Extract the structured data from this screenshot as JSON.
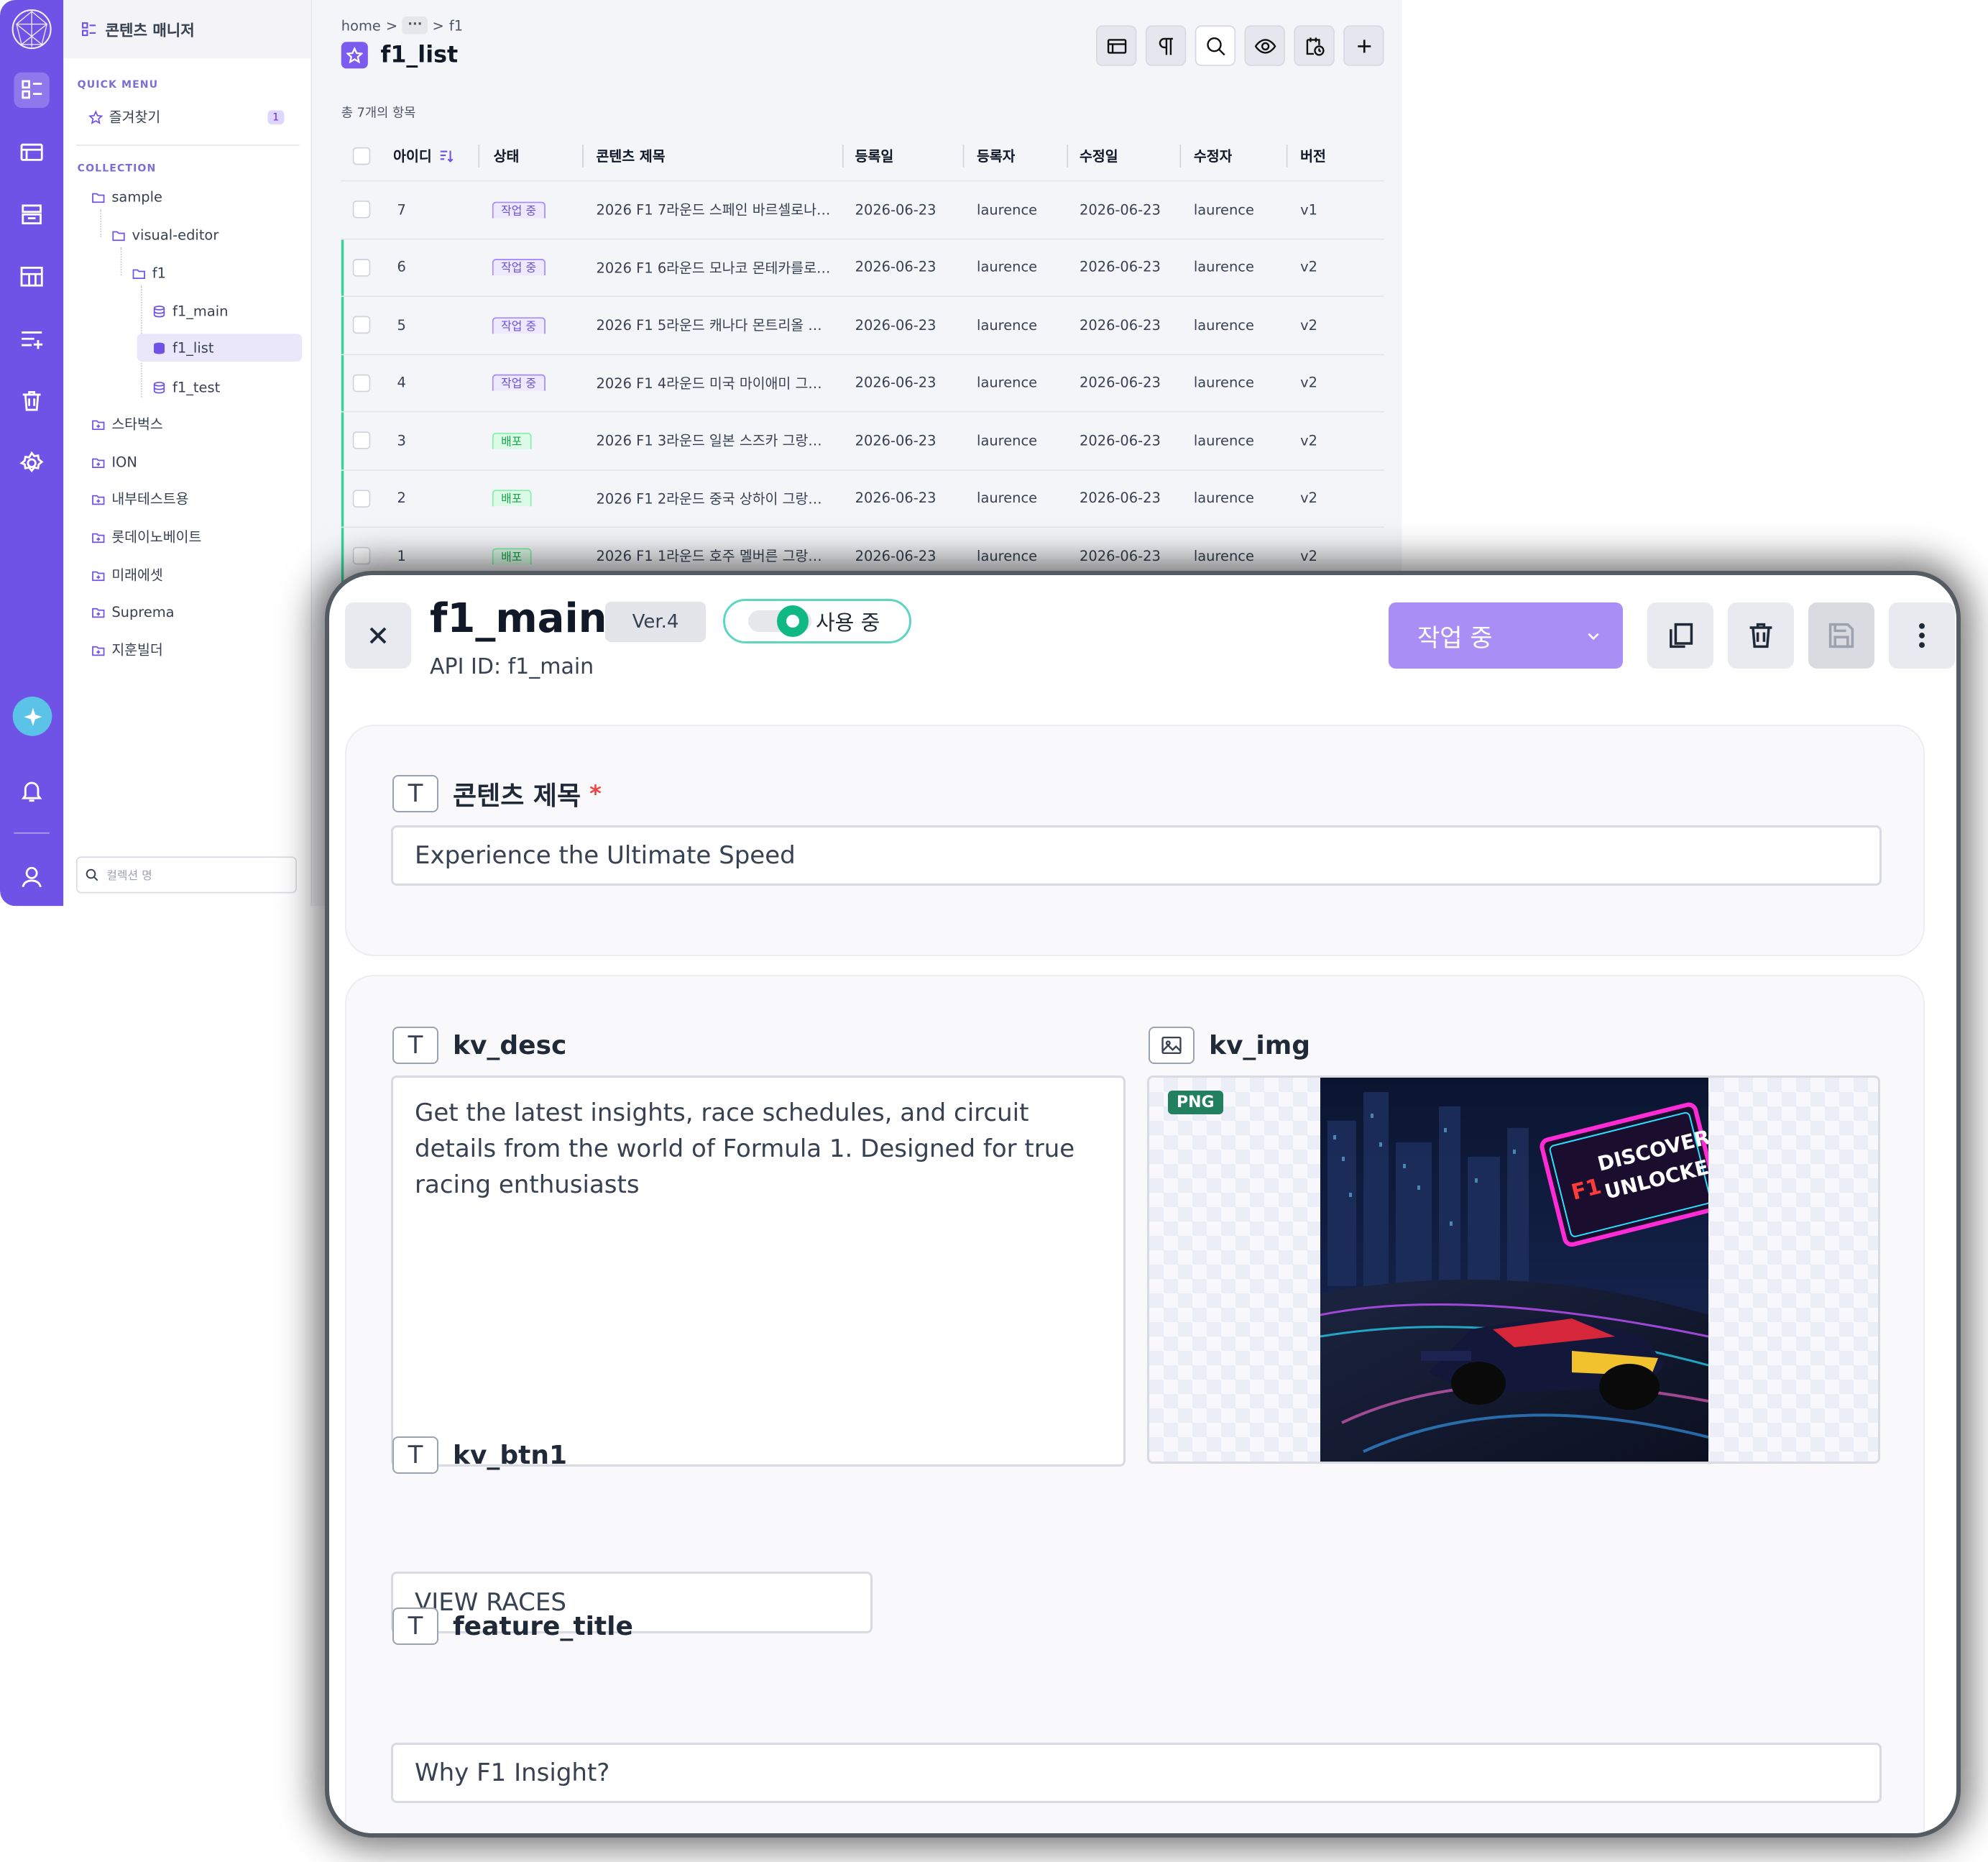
{
  "sidebar": {
    "header": "콘텐츠 매니저",
    "quick_menu_label": "QUICK MENU",
    "favorites_label": "즐겨찾기",
    "favorites_count": "1",
    "collection_label": "COLLECTION",
    "tree": [
      {
        "label": "sample"
      },
      {
        "label": "visual-editor"
      },
      {
        "label": "f1"
      },
      {
        "label": "f1_main"
      },
      {
        "label": "f1_list"
      },
      {
        "label": "f1_test"
      },
      {
        "label": "스타벅스"
      },
      {
        "label": "ION"
      },
      {
        "label": "내부테스트용"
      },
      {
        "label": "롯데이노베이트"
      },
      {
        "label": "미래에셋"
      },
      {
        "label": "Suprema"
      },
      {
        "label": "지훈빌더"
      }
    ],
    "search_placeholder": "컬렉션 명"
  },
  "breadcrumb": {
    "home": "home",
    "sep1": ">",
    "dots": "···",
    "sep2": ">",
    "current": "f1"
  },
  "page": {
    "title": "f1_list",
    "total": "총 7개의 항목"
  },
  "table": {
    "headers": {
      "id": "아이디",
      "status": "상태",
      "title": "콘텐츠 제목",
      "created": "등록일",
      "creator": "등록자",
      "modified": "수정일",
      "modifier": "수정자",
      "version": "버전"
    },
    "rows": [
      {
        "id": "7",
        "status": "작업 중",
        "title": "2026 F1 7라운드 스페인 바르셀로나…",
        "created": "2026-06-23",
        "creator": "laurence",
        "modified": "2026-06-23",
        "modifier": "laurence",
        "version": "v1"
      },
      {
        "id": "6",
        "status": "작업 중",
        "title": "2026 F1 6라운드 모나코 몬테카를로…",
        "created": "2026-06-23",
        "creator": "laurence",
        "modified": "2026-06-23",
        "modifier": "laurence",
        "version": "v2"
      },
      {
        "id": "5",
        "status": "작업 중",
        "title": "2026 F1 5라운드 캐나다 몬트리올 …",
        "created": "2026-06-23",
        "creator": "laurence",
        "modified": "2026-06-23",
        "modifier": "laurence",
        "version": "v2"
      },
      {
        "id": "4",
        "status": "작업 중",
        "title": "2026 F1 4라운드 미국 마이애미 그…",
        "created": "2026-06-23",
        "creator": "laurence",
        "modified": "2026-06-23",
        "modifier": "laurence",
        "version": "v2"
      },
      {
        "id": "3",
        "status": "배포",
        "title": "2026 F1 3라운드 일본 스즈카 그랑…",
        "created": "2026-06-23",
        "creator": "laurence",
        "modified": "2026-06-23",
        "modifier": "laurence",
        "version": "v2"
      },
      {
        "id": "2",
        "status": "배포",
        "title": "2026 F1 2라운드 중국 상하이 그랑…",
        "created": "2026-06-23",
        "creator": "laurence",
        "modified": "2026-06-23",
        "modifier": "laurence",
        "version": "v2"
      },
      {
        "id": "1",
        "status": "배포",
        "title": "2026 F1 1라운드 호주 멜버른 그랑…",
        "created": "2026-06-23",
        "creator": "laurence",
        "modified": "2026-06-23",
        "modifier": "laurence",
        "version": "v2"
      }
    ]
  },
  "editor": {
    "title": "f1_main",
    "version": "Ver.4",
    "toggle_label": "사용 중",
    "api_id": "API ID: f1_main",
    "status_select": "작업 중",
    "fields": {
      "content_title": {
        "label": "콘텐츠 제목",
        "required_mark": "*",
        "value": "Experience the Ultimate Speed",
        "type_icon": "T"
      },
      "kv_desc": {
        "label": "kv_desc",
        "value": "Get the latest insights, race schedules, and circuit details from the world of Formula 1. Designed for true racing enthusiasts",
        "type_icon": "T"
      },
      "kv_img": {
        "label": "kv_img",
        "badge": "PNG"
      },
      "kv_btn1": {
        "label": "kv_btn1",
        "value": "VIEW RACES",
        "type_icon": "T"
      },
      "feature_title": {
        "label": "feature_title",
        "value": "Why F1 Insight?",
        "type_icon": "T"
      }
    },
    "image_text": {
      "line1": "DISCOVER",
      "line2": "UNLOCKED",
      "logo": "F1"
    }
  },
  "colors": {
    "brand": "#6f52e6",
    "accent_light": "#a98ff5",
    "success": "#10b981",
    "working_chip": "#6d4fe0",
    "live_chip": "#16a34a"
  }
}
